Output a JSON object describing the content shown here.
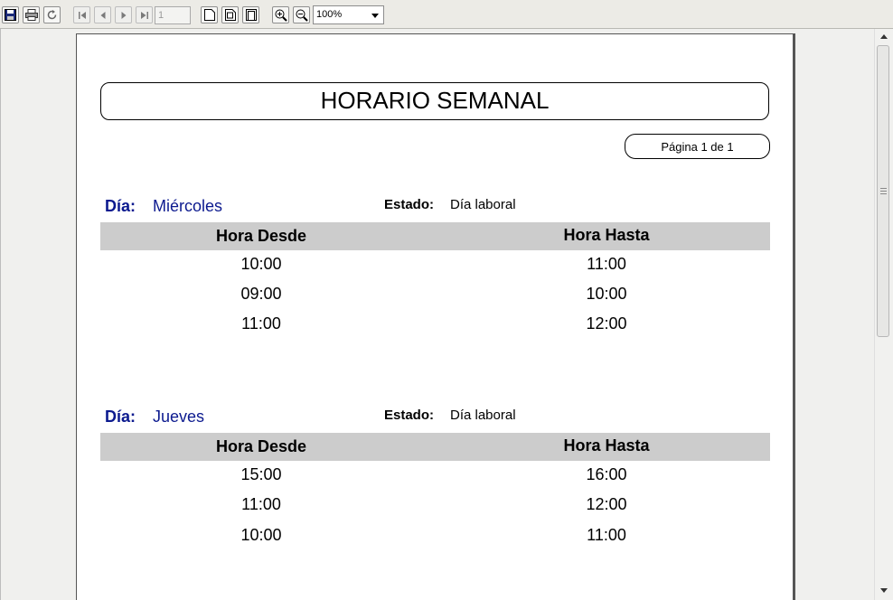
{
  "toolbar": {
    "page_number": "1",
    "zoom": "100%",
    "icons": [
      "save-icon",
      "print-icon",
      "refresh-icon",
      "first-page-icon",
      "previous-page-icon",
      "next-page-icon",
      "last-page-icon",
      "page-width-icon",
      "whole-page-icon",
      "two-pages-icon",
      "zoom-in-icon",
      "zoom-out-icon"
    ]
  },
  "report": {
    "title": "HORARIO SEMANAL",
    "page_info": "Página 1 de 1",
    "day_label": "Día:",
    "estado_label": "Estado:",
    "col_desde": "Hora Desde",
    "col_hasta": "Hora Hasta",
    "days": [
      {
        "name": "Miércoles",
        "estado": "Día laboral",
        "rows": [
          {
            "desde": "10:00",
            "hasta": "11:00"
          },
          {
            "desde": "09:00",
            "hasta": "10:00"
          },
          {
            "desde": "11:00",
            "hasta": "12:00"
          }
        ]
      },
      {
        "name": "Jueves",
        "estado": "Día laboral",
        "rows": [
          {
            "desde": "15:00",
            "hasta": "16:00"
          },
          {
            "desde": "11:00",
            "hasta": "12:00"
          },
          {
            "desde": "10:00",
            "hasta": "11:00"
          }
        ]
      }
    ]
  }
}
